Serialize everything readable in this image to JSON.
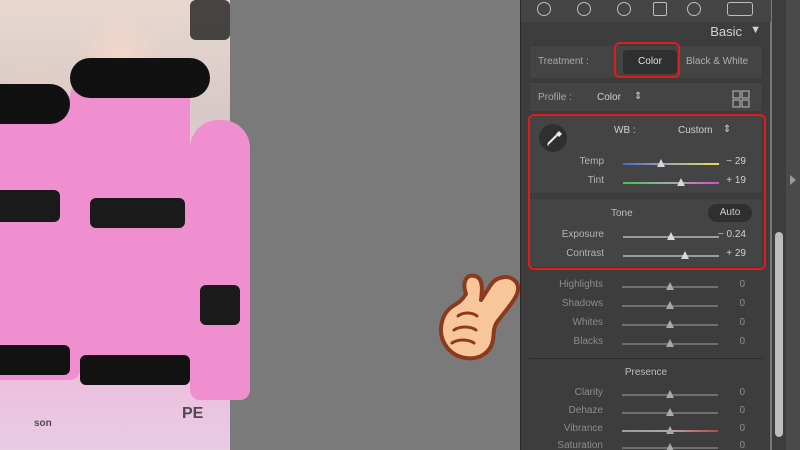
{
  "panel": {
    "section_title": "Basic",
    "treatment_label": "Treatment :",
    "treatment_color": "Color",
    "treatment_bw": "Black & White",
    "profile_label": "Profile :",
    "profile_value": "Color",
    "wb_label": "WB :",
    "wb_value": "Custom",
    "temp_label": "Temp",
    "temp_value": "− 29",
    "tint_label": "Tint",
    "tint_value": "+ 19",
    "tone_label": "Tone",
    "auto_label": "Auto",
    "exposure_label": "Exposure",
    "exposure_value": "− 0.24",
    "contrast_label": "Contrast",
    "contrast_value": "+ 29",
    "highlights_label": "Highlights",
    "highlights_value": "0",
    "shadows_label": "Shadows",
    "shadows_value": "0",
    "whites_label": "Whites",
    "whites_value": "0",
    "blacks_label": "Blacks",
    "blacks_value": "0",
    "presence_label": "Presence",
    "clarity_label": "Clarity",
    "clarity_value": "0",
    "dehaze_label": "Dehaze",
    "dehaze_value": "0",
    "vibrance_label": "Vibrance",
    "vibrance_value": "0",
    "saturation_label": "Saturation",
    "saturation_value": "0"
  },
  "photo": {
    "logo_text_1": "son",
    "logo_text_2": "PE"
  },
  "colors": {
    "highlight": "#e01d1d",
    "hand_fill": "#f7c79b",
    "hand_outline": "#8b3a1e"
  }
}
